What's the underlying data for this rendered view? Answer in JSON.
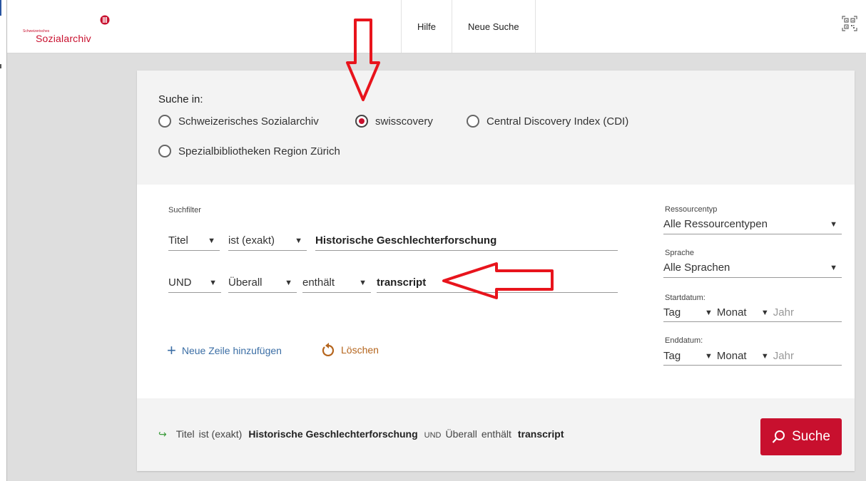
{
  "header": {
    "logo_small": "Schweizerisches",
    "logo_big": "Sozialarchiv",
    "nav": [
      "Hilfe",
      "Neue Suche"
    ],
    "qr_icon": "qr-code-icon"
  },
  "scope": {
    "title": "Suche in:",
    "options": [
      {
        "label": "Schweizerisches Sozialarchiv",
        "selected": false
      },
      {
        "label": "swisscovery",
        "selected": true
      },
      {
        "label": "Central Discovery Index (CDI)",
        "selected": false
      },
      {
        "label": "Spezialbibliotheken Region Zürich",
        "selected": false
      }
    ]
  },
  "filters": {
    "label": "Suchfilter",
    "rows": [
      {
        "field": "Titel",
        "operator": "ist (exakt)",
        "value": "Historische Geschlechterforschung"
      },
      {
        "boolean": "UND",
        "field": "Überall",
        "operator": "enthält",
        "value": "transcript"
      }
    ],
    "add_row": "Neue Zeile hinzufügen",
    "clear": "Löschen"
  },
  "side": {
    "resource_label": "Ressourcentyp",
    "resource_value": "Alle Ressourcentypen",
    "language_label": "Sprache",
    "language_value": "Alle Sprachen",
    "start_label": "Startdatum:",
    "end_label": "Enddatum:",
    "day": "Tag",
    "month": "Monat",
    "year": "Jahr"
  },
  "summary": {
    "field1": "Titel",
    "op1": "ist (exakt)",
    "val1": "Historische Geschlechterforschung",
    "bool": "UND",
    "field2": "Überall",
    "op2": "enthält",
    "val2": "transcript"
  },
  "search_button": "Suche",
  "colors": {
    "accent": "#c8102e",
    "link": "#3b6ea5",
    "clear": "#b5651d",
    "annotation": "#e8141c"
  }
}
